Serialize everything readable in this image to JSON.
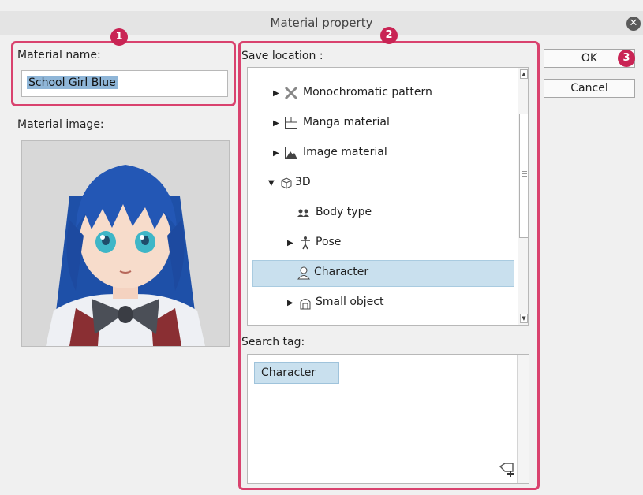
{
  "dialog": {
    "title": "Material property",
    "close_icon": "close-icon"
  },
  "left": {
    "material_name_label": "Material name:",
    "material_name_value": "School Girl Blue",
    "material_image_label": "Material image:"
  },
  "middle": {
    "save_location_label": "Save location :",
    "tree": [
      {
        "label": "Monochromatic pattern",
        "icon": "monochromatic-pattern-icon",
        "expander": "collapsed"
      },
      {
        "label": "Manga material",
        "icon": "manga-material-icon",
        "expander": "collapsed"
      },
      {
        "label": "Image material",
        "icon": "image-material-icon",
        "expander": "collapsed"
      },
      {
        "label": "3D",
        "icon": "cube-icon",
        "expander": "expanded"
      },
      {
        "label": "Body type",
        "icon": "body-type-icon",
        "expander": "none"
      },
      {
        "label": "Pose",
        "icon": "pose-icon",
        "expander": "collapsed"
      },
      {
        "label": "Character",
        "icon": "character-icon",
        "expander": "none",
        "selected": true
      },
      {
        "label": "Small object",
        "icon": "small-object-icon",
        "expander": "collapsed"
      }
    ],
    "search_tag_label": "Search tag:",
    "tags": [
      "Character"
    ]
  },
  "right": {
    "ok_label": "OK",
    "cancel_label": "Cancel"
  },
  "callouts": [
    "1",
    "2",
    "3"
  ],
  "colors": {
    "callout_border": "#d9426e",
    "badge": "#c92454",
    "selection": "#c9e0ee",
    "name_highlight": "#8fb6d8"
  }
}
